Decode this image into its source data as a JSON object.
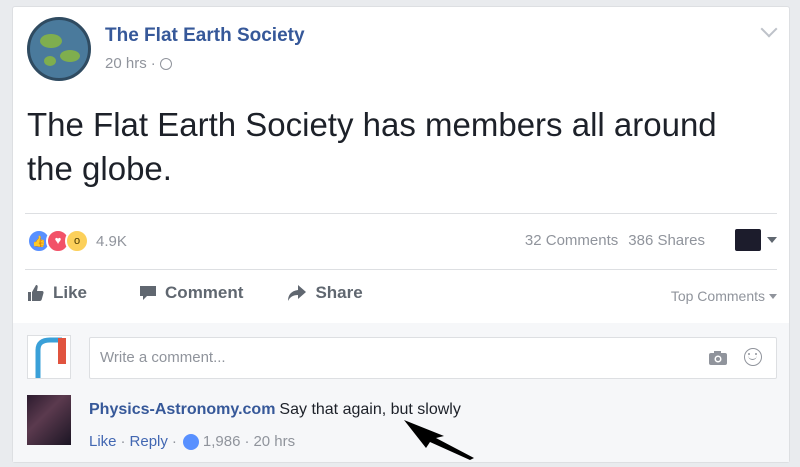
{
  "post": {
    "page_name": "The Flat Earth Society",
    "time": "20 hrs",
    "privacy_icon": "globe-icon",
    "text": "The Flat Earth Society has members all around the globe."
  },
  "stats": {
    "reaction_count": "4.9K",
    "comments": "32 Comments",
    "shares": "386 Shares"
  },
  "actions": {
    "like": "Like",
    "comment": "Comment",
    "share": "Share",
    "sort": "Top Comments"
  },
  "composer": {
    "placeholder": "Write a comment..."
  },
  "comment": {
    "author": "Physics-Astronomy.com",
    "text": "Say that again, but slowly",
    "like_label": "Like",
    "reply_label": "Reply",
    "like_count": "1,986",
    "time": "20 hrs"
  },
  "colors": {
    "link": "#365899",
    "like_blue": "#5890ff",
    "love_red": "#f25268",
    "wow_yellow": "#fcd05a"
  }
}
